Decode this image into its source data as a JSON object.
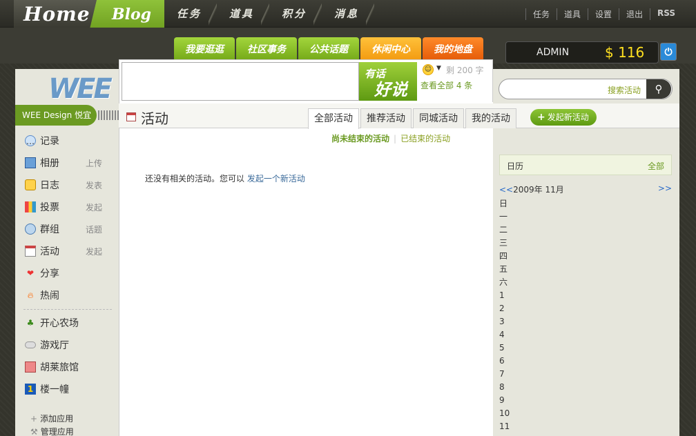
{
  "header": {
    "home_label": "Home",
    "blog_label": "Blog",
    "nav": [
      "任务",
      "道具",
      "积分",
      "消息"
    ],
    "toplinks": [
      "任务",
      "道具",
      "设置",
      "退出",
      "RSS"
    ]
  },
  "subtabs": [
    {
      "label": "我要逛逛",
      "color": "green"
    },
    {
      "label": "社区事务",
      "color": "green"
    },
    {
      "label": "公共话题",
      "color": "green"
    },
    {
      "label": "休闲中心",
      "color": "orange"
    },
    {
      "label": "我的地盘",
      "color": "red"
    }
  ],
  "user": {
    "name": "ADMIN",
    "coins": "$ 116",
    "power_icon": "power-icon"
  },
  "sidebar": {
    "logo": "WEE",
    "site_button": "WEE Design 悦宜",
    "items": [
      {
        "label": "记录",
        "action": "",
        "icon": "speech-bubble-icon"
      },
      {
        "label": "相册",
        "action": "上传",
        "icon": "photo-icon"
      },
      {
        "label": "日志",
        "action": "发表",
        "icon": "journal-icon"
      },
      {
        "label": "投票",
        "action": "发起",
        "icon": "bar-chart-icon"
      },
      {
        "label": "群组",
        "action": "话题",
        "icon": "group-icon"
      },
      {
        "label": "活动",
        "action": "发起",
        "icon": "calendar-icon"
      },
      {
        "label": "分享",
        "action": "",
        "icon": "hearts-icon"
      },
      {
        "label": "热闹",
        "action": "",
        "icon": "fire-icon"
      }
    ],
    "apps": [
      {
        "label": "开心农场",
        "icon": "sprout-icon"
      },
      {
        "label": "游戏厅",
        "icon": "gamepad-icon"
      },
      {
        "label": "胡莱旅馆",
        "icon": "hotel-icon"
      },
      {
        "label": "楼一幢",
        "icon": "building-icon"
      }
    ],
    "add_app": "添加应用",
    "manage_app": "管理应用"
  },
  "post": {
    "button_line1": "有话",
    "button_line2": "好说",
    "remaining": "剩 200 字",
    "view_all": "查看全部 4 条"
  },
  "search": {
    "placeholder": "搜索活动"
  },
  "main": {
    "title": "活动",
    "tabs": [
      "全部活动",
      "推荐活动",
      "同城活动",
      "我的活动"
    ],
    "new_button": "发起新活动",
    "filter_active": "尚未结束的活动",
    "filter_other": "已结束的活动",
    "empty_text": "还没有相关的活动。您可以",
    "empty_link": "发起一个新活动"
  },
  "calendar": {
    "title": "日历",
    "all": "全部",
    "prev": "<<",
    "month": "2009年 11月",
    "next": ">>",
    "weekdays": [
      "日",
      "一",
      "二",
      "三",
      "四",
      "五",
      "六"
    ],
    "days": [
      "1",
      "2",
      "3",
      "4",
      "5",
      "6",
      "7",
      "8",
      "9",
      "10",
      "11"
    ]
  }
}
